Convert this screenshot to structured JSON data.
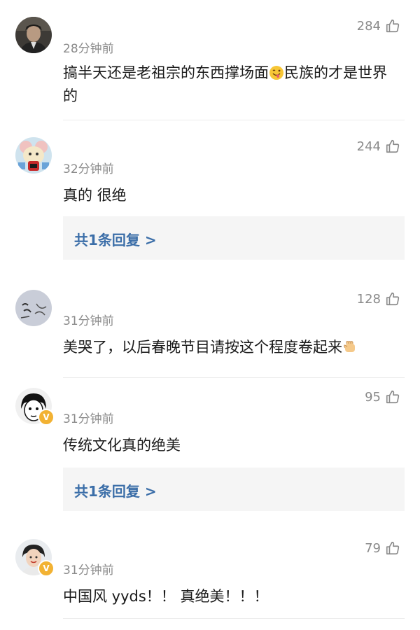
{
  "comments": [
    {
      "time": "28分钟前",
      "likes": "284",
      "text_part1": "搞半天还是老祖宗的东西撑场面",
      "emoji": "tongue-wink-emoji",
      "text_part2": "民族的才是世界的"
    },
    {
      "time": "32分钟前",
      "likes": "244",
      "text": "真的 很绝",
      "reply_label": "共1条回复 >"
    },
    {
      "time": "31分钟前",
      "likes": "128",
      "text": "美哭了，以后春晚节目请按这个程度卷起来",
      "emoji": "fist-emoji"
    },
    {
      "time": "31分钟前",
      "likes": "95",
      "text": "传统文化真的绝美",
      "reply_label": "共1条回复 >",
      "verified": "V"
    },
    {
      "time": "31分钟前",
      "likes": "79",
      "text": "中国风 yyds！！ 真绝美！！！",
      "verified": "V"
    }
  ],
  "colors": {
    "link": "#3b6ea8",
    "muted": "#8a8a8a",
    "reply_bg": "#f5f5f5",
    "badge": "#f2b233"
  }
}
